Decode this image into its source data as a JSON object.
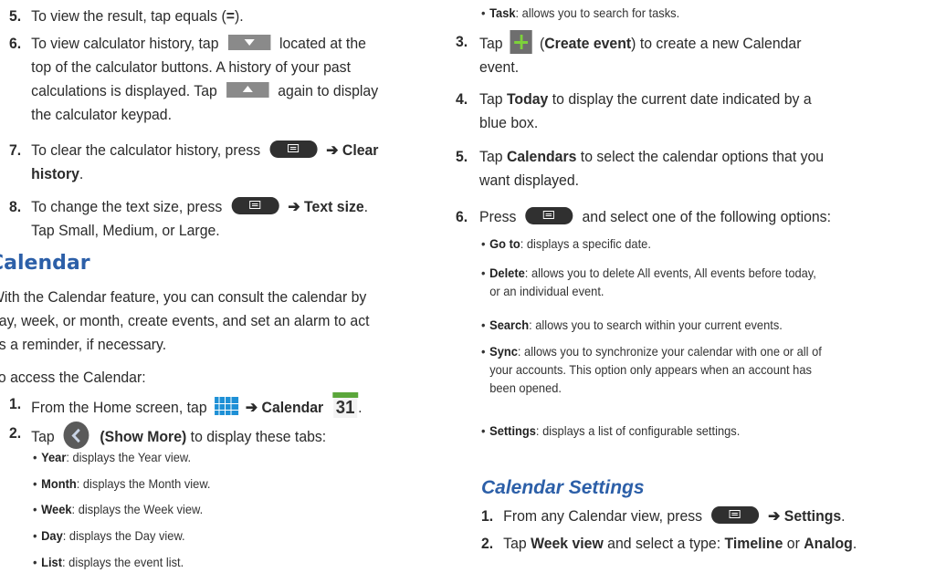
{
  "left": {
    "step5": {
      "num": "5.",
      "pre": "To view the result, tap equals (",
      "key": "=",
      "post": ")."
    },
    "step6": {
      "num": "6.",
      "pre": "To view calculator history, tap",
      "mid1": "located at the",
      "line2": "top of the calculator buttons. A history of your past",
      "line3a": "calculations is displayed. Tap",
      "line3b": "again to display",
      "line4": "the calculator keypad."
    },
    "step7": {
      "num": "7.",
      "pre": "To clear the calculator history, press",
      "arrow": "➔",
      "bold1": "Clear",
      "bold2": "history",
      "post": "."
    },
    "step8": {
      "num": "8.",
      "pre": "To change the text size, press",
      "arrow": "➔",
      "bold": "Text size",
      "post": ".",
      "line2": "Tap Small, Medium, or Large."
    },
    "heading": "Calendar",
    "intro": [
      "With the Calendar feature, you can consult the calendar by",
      "day, week, or month, create events, and set an alarm to act",
      "as a reminder, if necessary."
    ],
    "access": "To access the Calendar:",
    "s1": {
      "num": "1.",
      "pre": "From the Home screen, tap",
      "arrow": "➔",
      "bold": "Calendar",
      "icon_num": "31",
      "post": "."
    },
    "s2": {
      "num": "2.",
      "pre": "Tap",
      "bold": "(Show More)",
      "post": "to display these tabs:"
    },
    "tabs": [
      {
        "k": "Year",
        "v": ": displays the Year view."
      },
      {
        "k": "Month",
        "v": ": displays the Month view."
      },
      {
        "k": "Week",
        "v": ": displays the Week view."
      },
      {
        "k": "Day",
        "v": ": displays the Day view."
      },
      {
        "k": "List",
        "v": ": displays the event list."
      }
    ]
  },
  "right": {
    "task": {
      "k": "Task",
      "v": ": allows you to search for tasks."
    },
    "s3": {
      "num": "3.",
      "pre": "Tap",
      "bold": "Create event",
      "post": "to create a new Calendar",
      "line2": "event."
    },
    "s4": {
      "num": "4.",
      "pre": "Tap",
      "bold": "Today",
      "post": "to display the current date indicated by a",
      "line2": "blue box."
    },
    "s5": {
      "num": "5.",
      "pre": "Tap",
      "bold": "Calendars",
      "post": "to select the calendar options that you",
      "line2": "want displayed."
    },
    "s6": {
      "num": "6.",
      "pre": "Press",
      "post": "and select one of the following options:"
    },
    "opts": {
      "goto": {
        "k": "Go to",
        "v": ": displays a specific date."
      },
      "delete": {
        "k": "Delete",
        "v": ": allows you to delete All events, All events before today,",
        "v2": "or an individual event."
      },
      "search": {
        "k": "Search",
        "v": ": allows you to search within your current events."
      },
      "sync": {
        "k": "Sync",
        "v": ": allows you to synchronize your calendar with one or all of",
        "v2": "your accounts. This option only appears when an account has",
        "v3": "been opened."
      },
      "settings": {
        "k": "Settings",
        "v": ": displays a list of configurable settings."
      }
    },
    "heading": "Calendar Settings",
    "cs1": {
      "num": "1.",
      "pre": "From any Calendar view, press",
      "arrow": "➔",
      "bold": "Settings",
      "post": "."
    },
    "cs2": {
      "num": "2.",
      "pre": "Tap",
      "bold1": "Week view",
      "mid": "and select a type:",
      "bold2": "Timeline",
      "or": "or",
      "bold3": "Analog",
      "post": "."
    }
  }
}
